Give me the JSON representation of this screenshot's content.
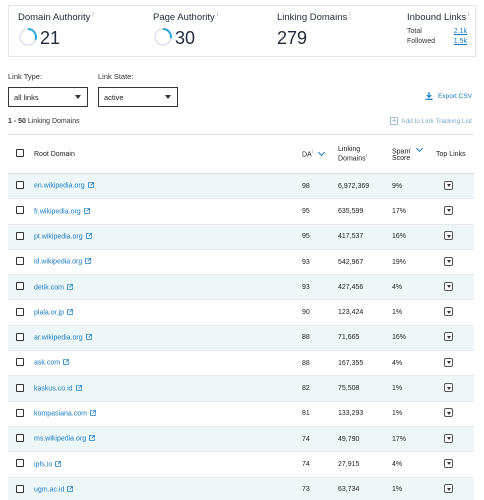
{
  "metrics": {
    "domain_authority": {
      "label": "Domain Authority",
      "value": "21"
    },
    "page_authority": {
      "label": "Page Authority",
      "value": "30"
    },
    "linking_domains": {
      "label": "Linking Domains",
      "value": "279"
    },
    "inbound_links": {
      "label": "Inbound Links",
      "total_label": "Total",
      "total_value": "2.1k",
      "followed_label": "Followed",
      "followed_value": "1.5k"
    },
    "info_marker": "i"
  },
  "filters": {
    "link_type_label": "Link Type:",
    "link_type_value": "all links",
    "link_state_label": "Link State:",
    "link_state_value": "active"
  },
  "export_label": "Export CSV",
  "count_prefix": "1 - 50",
  "count_suffix": "Linking Domains",
  "add_to_list_label": "Add to Link Tracking List",
  "table": {
    "headers": {
      "root_domain": "Root Domain",
      "da": "DA",
      "linking_domains_1": "Linking",
      "linking_domains_2": "Domains",
      "spam_1": "Spam",
      "spam_2": "Score",
      "top_links": "Top Links"
    },
    "rows": [
      {
        "domain": "en.wikipedia.org",
        "da": "98",
        "linking": "6,972,369",
        "spam": "9%"
      },
      {
        "domain": "fr.wikipedia.org",
        "da": "95",
        "linking": "635,599",
        "spam": "17%"
      },
      {
        "domain": "pt.wikipedia.org",
        "da": "95",
        "linking": "417,537",
        "spam": "16%"
      },
      {
        "domain": "id.wikipedia.org",
        "da": "93",
        "linking": "542,967",
        "spam": "19%"
      },
      {
        "domain": "detik.com",
        "da": "93",
        "linking": "427,456",
        "spam": "4%"
      },
      {
        "domain": "plala.or.jp",
        "da": "90",
        "linking": "123,424",
        "spam": "1%"
      },
      {
        "domain": "ar.wikipedia.org",
        "da": "88",
        "linking": "71,665",
        "spam": "16%"
      },
      {
        "domain": "ask.com",
        "da": "88",
        "linking": "167,355",
        "spam": "4%"
      },
      {
        "domain": "kaskus.co.id",
        "da": "82",
        "linking": "75,508",
        "spam": "1%"
      },
      {
        "domain": "kompasiana.com",
        "da": "81",
        "linking": "133,293",
        "spam": "1%"
      },
      {
        "domain": "ms.wikipedia.org",
        "da": "74",
        "linking": "49,790",
        "spam": "17%"
      },
      {
        "domain": "ipfs.io",
        "da": "74",
        "linking": "27,915",
        "spam": "4%"
      },
      {
        "domain": "ugm.ac.id",
        "da": "73",
        "linking": "63,734",
        "spam": "1%"
      }
    ]
  },
  "colors": {
    "link": "#1a7bc4",
    "ring": "#2aa8d8",
    "row_alt": "#eef7f8"
  },
  "icons": {
    "external": "external-link-icon",
    "download": "download-icon",
    "top_links": "dropdown-toggle-icon"
  }
}
